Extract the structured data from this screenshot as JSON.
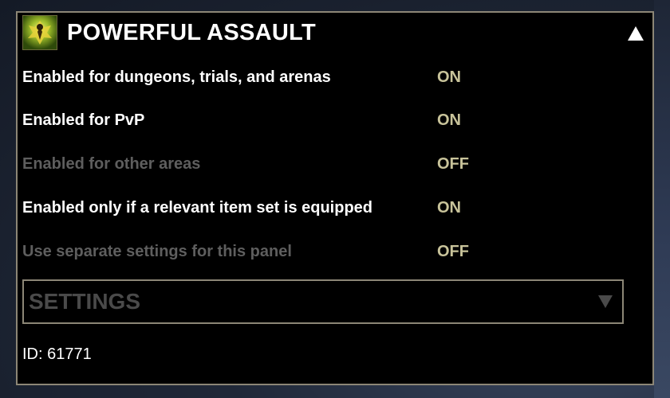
{
  "panel": {
    "title": "POWERFUL ASSAULT",
    "icon": "powerful-assault-set-icon",
    "collapse_icon": "triangle-up-icon"
  },
  "settings_rows": [
    {
      "label": "Enabled for dungeons, trials, and arenas",
      "value": "ON",
      "enabled": true
    },
    {
      "label": "Enabled for PvP",
      "value": "ON",
      "enabled": true
    },
    {
      "label": "Enabled for other areas",
      "value": "OFF",
      "enabled": false
    },
    {
      "label": "Enabled only if a relevant item set is equipped",
      "value": "ON",
      "enabled": true
    },
    {
      "label": "Use separate settings for this panel",
      "value": "OFF",
      "enabled": false
    }
  ],
  "settings_dropdown": {
    "label": "SETTINGS",
    "arrow_icon": "triangle-down-icon"
  },
  "id_text": "ID: 61771",
  "colors": {
    "panel_background": "#000000",
    "border": "#8c8676",
    "value_text": "#c8c39a",
    "enabled_text": "#ffffff",
    "disabled_text": "#5e5e5e"
  }
}
